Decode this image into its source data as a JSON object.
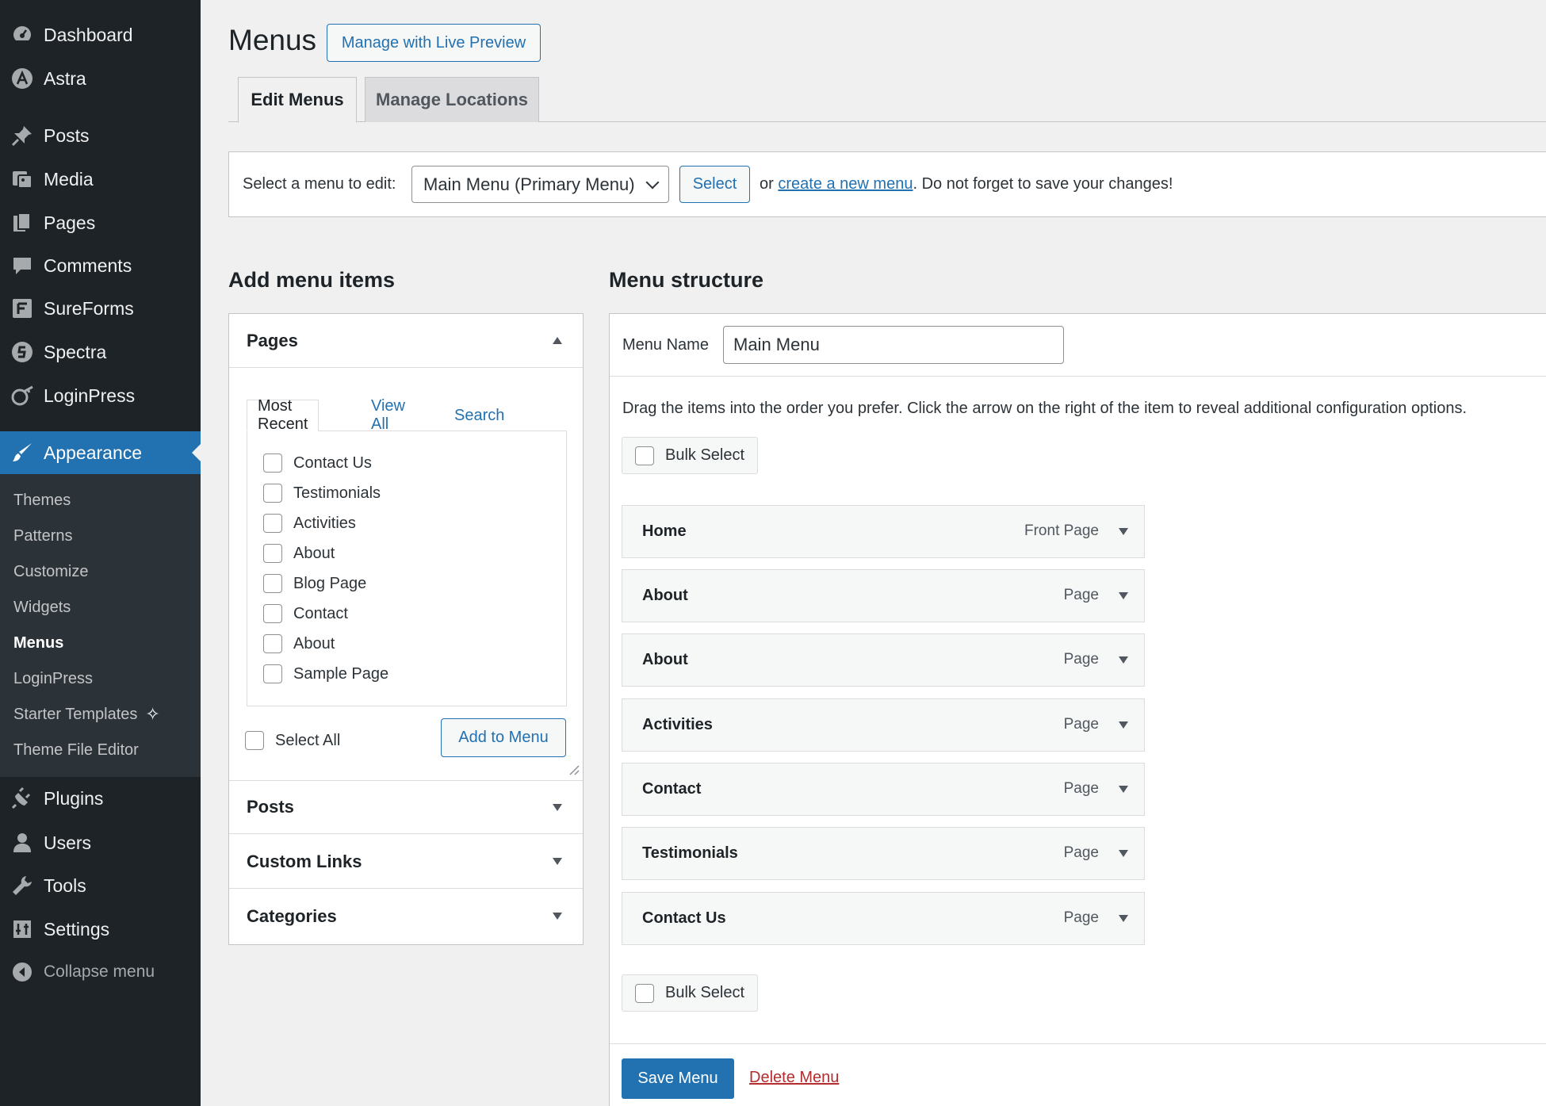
{
  "sidebar": {
    "items": [
      {
        "label": "Dashboard",
        "icon": "dashboard-icon"
      },
      {
        "label": "Astra",
        "icon": "astra-icon"
      },
      {
        "label": "Posts",
        "icon": "pin-icon"
      },
      {
        "label": "Media",
        "icon": "media-icon"
      },
      {
        "label": "Pages",
        "icon": "pages-icon"
      },
      {
        "label": "Comments",
        "icon": "comments-icon"
      },
      {
        "label": "SureForms",
        "icon": "sureforms-icon"
      },
      {
        "label": "Spectra",
        "icon": "spectra-icon"
      },
      {
        "label": "LoginPress",
        "icon": "loginpress-icon"
      },
      {
        "label": "Appearance",
        "icon": "brush-icon"
      },
      {
        "label": "Plugins",
        "icon": "plugin-icon"
      },
      {
        "label": "Users",
        "icon": "users-icon"
      },
      {
        "label": "Tools",
        "icon": "wrench-icon"
      },
      {
        "label": "Settings",
        "icon": "settings-icon"
      },
      {
        "label": "Collapse menu",
        "icon": "collapse-icon"
      }
    ],
    "submenu": [
      "Themes",
      "Patterns",
      "Customize",
      "Widgets",
      "Menus",
      "LoginPress",
      "Starter Templates",
      "Theme File Editor"
    ]
  },
  "header": {
    "title": "Menus",
    "live_preview_label": "Manage with Live Preview",
    "tabs": [
      "Edit Menus",
      "Manage Locations"
    ]
  },
  "manage": {
    "prompt": "Select a menu to edit:",
    "selected_menu": "Main Menu (Primary Menu)",
    "select_button": "Select",
    "or_text": "or",
    "create_link": "create a new menu",
    "reminder": ". Do not forget to save your changes!"
  },
  "add_items": {
    "title": "Add menu items",
    "sections": [
      "Pages",
      "Posts",
      "Custom Links",
      "Categories"
    ],
    "tabs": [
      "Most Recent",
      "View All",
      "Search"
    ],
    "pages": [
      "Contact Us",
      "Testimonials",
      "Activities",
      "About",
      "Blog Page",
      "Contact",
      "About",
      "Sample Page"
    ],
    "select_all": "Select All",
    "add_button": "Add to Menu"
  },
  "structure": {
    "title": "Menu structure",
    "name_label": "Menu Name",
    "name_value": "Main Menu",
    "instructions": "Drag the items into the order you prefer. Click the arrow on the right of the item to reveal additional configuration options.",
    "bulk_select": "Bulk Select",
    "items": [
      {
        "title": "Home",
        "type": "Front Page"
      },
      {
        "title": "About",
        "type": "Page"
      },
      {
        "title": "About",
        "type": "Page"
      },
      {
        "title": "Activities",
        "type": "Page"
      },
      {
        "title": "Contact",
        "type": "Page"
      },
      {
        "title": "Testimonials",
        "type": "Page"
      },
      {
        "title": "Contact Us",
        "type": "Page"
      }
    ],
    "save_button": "Save Menu",
    "delete_link": "Delete Menu"
  },
  "colors": {
    "sidebar_bg": "#1d2327",
    "submenu_bg": "#2c3338",
    "accent": "#2271b1",
    "delete": "#b32d2e"
  }
}
